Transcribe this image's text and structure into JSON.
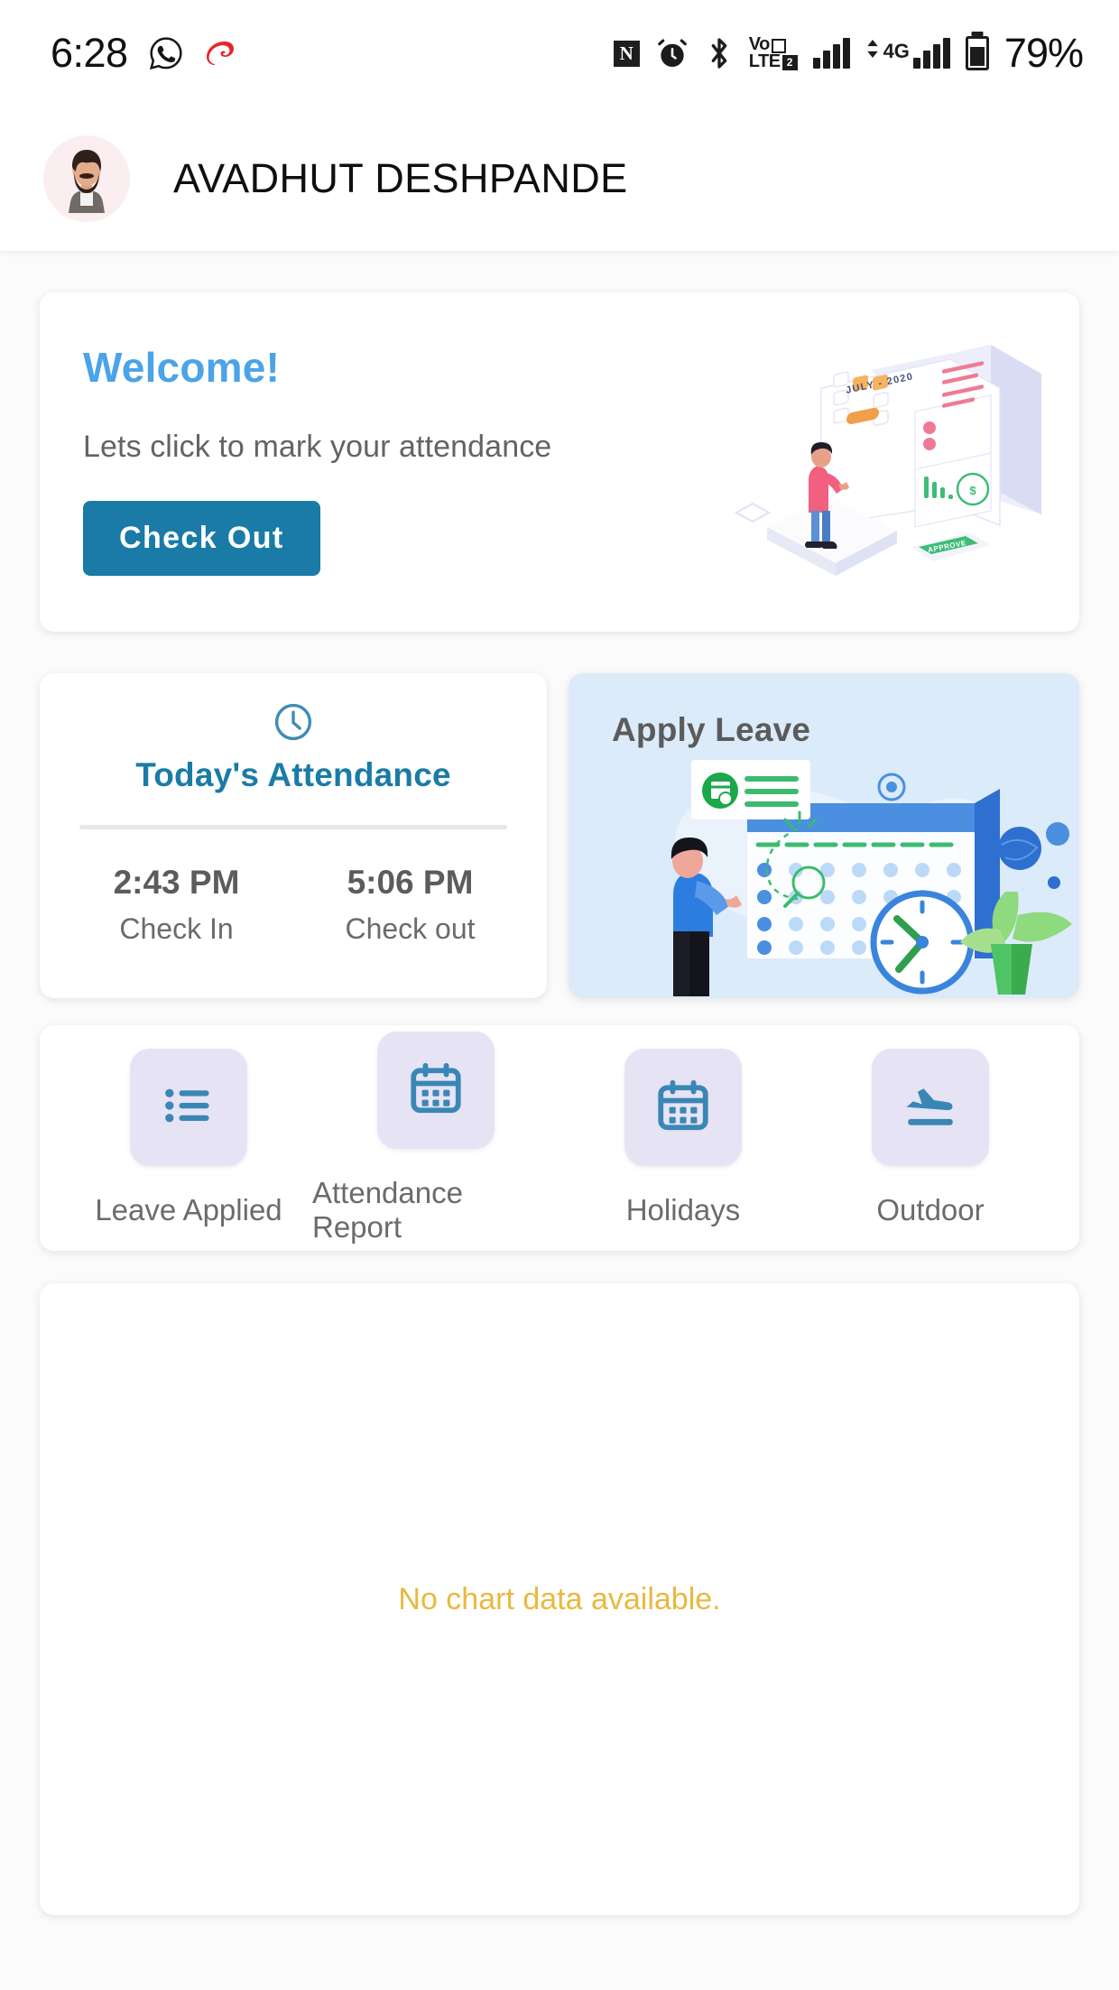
{
  "status_bar": {
    "time": "6:28",
    "left_icons": [
      "whatsapp-icon",
      "airtel-logo-icon"
    ],
    "nfc_label": "N",
    "volte_line1": "Vo",
    "volte_line2": "LTE",
    "volte_sim": "2",
    "network_type": "4G",
    "battery_percent": "79%",
    "right_icons": [
      "nfc-icon",
      "alarm-icon",
      "bluetooth-icon",
      "volte-icon",
      "signal-bars-icon",
      "data-arrows-icon",
      "signal-bars-2-icon",
      "battery-icon"
    ]
  },
  "header": {
    "user_name": "AVADHUT DESHPANDE",
    "avatar_alt": "user-avatar"
  },
  "welcome": {
    "title": "Welcome!",
    "subtitle": "Lets click to mark your attendance",
    "button_label": "Check Out",
    "illustration_label": "attendance-dashboard-illustration",
    "illustration_calendar_text": "JULY - 2020",
    "illustration_approve_text": "APPROVE"
  },
  "attendance": {
    "title": "Today's Attendance",
    "icon": "clock-icon",
    "check_in_time": "2:43 PM",
    "check_in_label": "Check In",
    "check_out_time": "5:06 PM",
    "check_out_label": "Check out"
  },
  "apply_leave": {
    "title": "Apply Leave",
    "illustration_label": "leave-calendar-illustration"
  },
  "quick_actions": [
    {
      "label": "Leave Applied",
      "icon": "list-icon"
    },
    {
      "label": "Attendance Report",
      "icon": "calendar-icon"
    },
    {
      "label": "Holidays",
      "icon": "calendar-icon"
    },
    {
      "label": "Outdoor",
      "icon": "airplane-takeoff-icon"
    }
  ],
  "chart": {
    "empty_message": "No chart data available."
  },
  "colors": {
    "accent_blue": "#4ba3e8",
    "teal": "#1a7ba6",
    "leave_card_bg": "#dcebf9",
    "tile_bg": "#e6e3f4",
    "warning": "#e9b93e",
    "page_bg": "#fbfbfb"
  }
}
